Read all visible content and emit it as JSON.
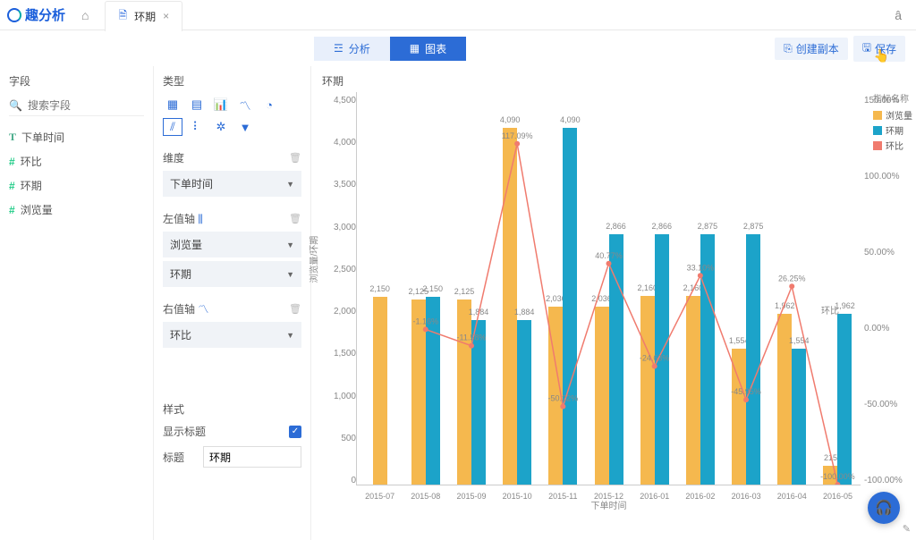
{
  "app": {
    "name": "趣分析",
    "tab": "环期"
  },
  "toolbar": {
    "analysis": "分析",
    "chart": "图表",
    "duplicate": "创建副本",
    "save": "保存"
  },
  "fields": {
    "title": "字段",
    "search_placeholder": "搜索字段",
    "list": [
      {
        "icon": "T",
        "label": "下单时间"
      },
      {
        "icon": "#",
        "label": "环比"
      },
      {
        "icon": "#",
        "label": "环期"
      },
      {
        "icon": "#",
        "label": "浏览量"
      }
    ]
  },
  "config": {
    "type_title": "类型",
    "dimension": {
      "title": "维度",
      "value": "下单时间"
    },
    "left_axis": {
      "title": "左值轴",
      "values": [
        "浏览量",
        "环期"
      ]
    },
    "right_axis": {
      "title": "右值轴",
      "values": [
        "环比"
      ]
    },
    "style": {
      "title": "样式",
      "show_title": "显示标题",
      "title_label": "标题",
      "title_value": "环期"
    }
  },
  "chart_data": {
    "type": "bar",
    "title": "环期",
    "xlabel": "下单时间",
    "ylabel_left": "浏览量/环期",
    "ylabel_right": "环比",
    "ylim_left": [
      0,
      4500
    ],
    "ylim_right": [
      -100,
      150
    ],
    "y_ticks_left": [
      0,
      500,
      1000,
      1500,
      2000,
      2500,
      3000,
      3500,
      4000,
      4500
    ],
    "y_ticks_right": [
      "-100.00%",
      "-50.00%",
      "0.00%",
      "50.00%",
      "100.00%",
      "150.00%"
    ],
    "categories": [
      "2015-07",
      "2015-08",
      "2015-09",
      "2015-10",
      "2015-11",
      "2015-12",
      "2016-01",
      "2016-02",
      "2016-03",
      "2016-04",
      "2016-05"
    ],
    "series": [
      {
        "name": "浏览量",
        "color": "#f5b84e",
        "type": "bar",
        "values": [
          2150,
          2125,
          2125,
          4090,
          2036,
          2036,
          2160,
          2160,
          1554,
          1962,
          215
        ]
      },
      {
        "name": "环期",
        "color": "#1ca3c9",
        "type": "bar",
        "values": [
          null,
          2150,
          1884,
          1884,
          4090,
          2866,
          2866,
          2875,
          2875,
          1554,
          1962
        ]
      },
      {
        "name": "环比",
        "color": "#f07b6e",
        "type": "line_pct",
        "values": [
          null,
          -1.16,
          -11.58,
          117.09,
          -50.22,
          40.77,
          -24.63,
          33.1,
          -45.95,
          26.25,
          -100.0
        ]
      }
    ],
    "legend_title": "指标名称"
  }
}
